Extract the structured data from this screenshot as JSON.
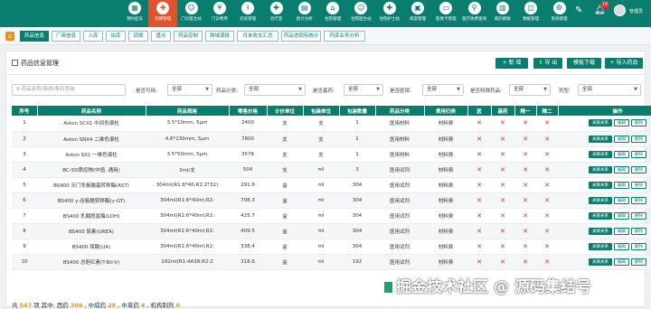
{
  "topnav": {
    "items": [
      {
        "label": "预约挂号",
        "icon": "calendar-icon"
      },
      {
        "label": "药库管理",
        "icon": "medicine-icon",
        "active": true
      },
      {
        "label": "门诊医生站",
        "icon": "doctor-icon"
      },
      {
        "label": "门诊费用",
        "icon": "fee-icon"
      },
      {
        "label": "药房管理",
        "icon": "pharmacy-icon"
      },
      {
        "label": "治疗室",
        "icon": "treatment-icon"
      },
      {
        "label": "统计分析",
        "icon": "chart-icon"
      },
      {
        "label": "住院管理",
        "icon": "inpatient-icon"
      },
      {
        "label": "住院医生站",
        "icon": "doctor-icon"
      },
      {
        "label": "住院护士站",
        "icon": "nurse-icon"
      },
      {
        "label": "病案管理",
        "icon": "record-icon"
      },
      {
        "label": "医保卡管理",
        "icon": "card-icon"
      },
      {
        "label": "医疗收费查询",
        "icon": "query-icon"
      },
      {
        "label": "病历模板",
        "icon": "template-icon"
      },
      {
        "label": "数据管理",
        "icon": "data-icon"
      },
      {
        "label": "系统管理",
        "icon": "settings-icon"
      }
    ],
    "notification_count": "10",
    "user": "管理员"
  },
  "tabs": [
    "药品信息",
    "厂商信息",
    "入库",
    "出库",
    "调拨",
    "盘点",
    "药品控制",
    "跨域调拨",
    "月末收支汇总",
    "药品进销存统计",
    "药库业务分析"
  ],
  "page_title": "药品信息管理",
  "actions": {
    "add": "+ 新 增",
    "export": "⇩ 导 出",
    "template": "模板下载",
    "import": "+ 导入药品"
  },
  "filters": {
    "search_placeholder": "药品名称/简拼/条码查询",
    "available_label": "是否可用:",
    "available_value": "全部",
    "category_label": "药品分类:",
    "category_value": "全部",
    "basic_label": "是否基药:",
    "basic_value": "全部",
    "insurance_label": "是否医保:",
    "insurance_value": "全部",
    "special_label": "是否特殊药品:",
    "special_value": "全部",
    "dosage_label": "剂型:",
    "dosage_value": "全部"
  },
  "table": {
    "headers": [
      "序号",
      "药品名称",
      "药品规格",
      "零售价格",
      "计价单位",
      "包装单位",
      "包装数量",
      "药品分类",
      "费用归类",
      "医",
      "基药",
      "精一",
      "精二",
      "操作"
    ],
    "rows": [
      [
        "1",
        "Aston SCX1 中间色谱柱",
        "3.5*10mm, 5μm",
        "2400",
        "支",
        "支",
        "1",
        "医用材料",
        "材料费"
      ],
      [
        "2",
        "Aston SNX4 二维色谱柱",
        "4.6*130mm, 5μm",
        "7800",
        "支",
        "支",
        "1",
        "医用材料",
        "材料费"
      ],
      [
        "3",
        "Aston SX1 一维色谱柱",
        "3.5*50mm, 5μm",
        "3576",
        "支",
        "支",
        "1",
        "医用材料",
        "材料费"
      ],
      [
        "4",
        "BC-5D质控物(中值, 通用)",
        "3ml/支",
        "504",
        "支",
        "ml",
        "3",
        "医用试剂",
        "材料费"
      ],
      [
        "5",
        "BS400 天门冬氨酸基转移酶(AST)",
        "304ml(R1:6*40:R2:2*32)",
        "291.6",
        "盒",
        "ml",
        "304",
        "医用试剂",
        "材料费"
      ],
      [
        "6",
        "BS400 γ-谷氨酰转移酶(γ-GT)",
        "304ml(R1:6*40ml,R2:",
        "708.3",
        "盒",
        "ml",
        "304",
        "医用试剂",
        "材料费"
      ],
      [
        "7",
        "BS400 乳酸脱氢酶(LDH)",
        "304ml(R1:6*40ml;R2:",
        "425.7",
        "盒",
        "ml",
        "304",
        "医用试剂",
        "材料费"
      ],
      [
        "8",
        "BS400 尿素(UREA)",
        "304ml(R1:6*40ml;R2:",
        "409.5",
        "盒",
        "ml",
        "304",
        "医用试剂",
        "材料费"
      ],
      [
        "9",
        "BS400 尿酸(UA)",
        "304ml(R1:6*40ml;R2:",
        "338.4",
        "盒",
        "ml",
        "304",
        "医用试剂",
        "材料费"
      ],
      [
        "10",
        "BS400 总胆红素(T-Bil-V)",
        "192ml(R1:4A38;R2:2",
        "318.6",
        "盒",
        "ml",
        "192",
        "医用试剂",
        "材料费"
      ]
    ],
    "flag": "✕",
    "op_relation": "关联关系",
    "op_edit": "编辑",
    "op_delete": "删除"
  },
  "footer": {
    "total_label": "共",
    "total": "547",
    "suffix": "项 其中:",
    "western_label": "西药",
    "western": "306",
    "chinese_label": "中成药",
    "chinese": "28",
    "herbal_label": "中草药",
    "herbal": "4",
    "prep_label": "机构制剂",
    "prep": "0"
  },
  "watermark": "掘金技术社区 @ 源码集结号"
}
